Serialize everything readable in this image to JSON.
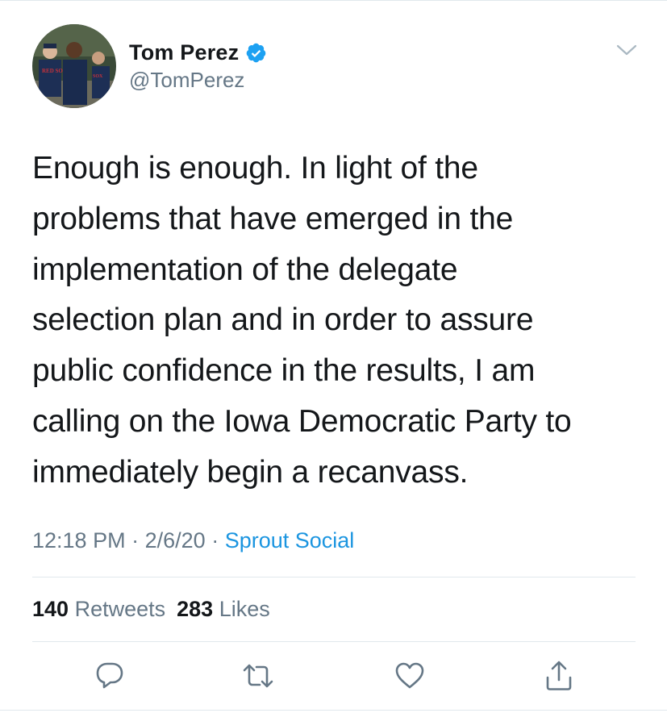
{
  "author": {
    "display_name": "Tom Perez",
    "handle": "@TomPerez",
    "verified": true,
    "avatar_icon": "profile-photo",
    "verified_icon": "verified-badge-icon",
    "verified_color": "#1da1f2"
  },
  "tweet": {
    "text_lines": [
      "Enough is enough. In light of the",
      "problems that have emerged in the",
      "implementation of the delegate",
      "selection plan and in order to assure",
      "public confidence in the results, I am",
      "calling on the Iowa Democratic Party to",
      "immediately begin a recanvass."
    ]
  },
  "meta": {
    "time": "12:18 PM",
    "separator": "·",
    "date": "2/6/20",
    "source": "Sprout Social",
    "source_color": "#1b95e0"
  },
  "stats": {
    "retweets_count": "140",
    "retweets_label": "Retweets",
    "likes_count": "283",
    "likes_label": "Likes"
  },
  "actions": [
    {
      "name": "reply",
      "icon": "reply-icon"
    },
    {
      "name": "retweet",
      "icon": "retweet-icon"
    },
    {
      "name": "like",
      "icon": "heart-icon"
    },
    {
      "name": "share",
      "icon": "share-icon"
    }
  ],
  "colors": {
    "text": "#14171a",
    "secondary": "#657786",
    "icon": "#657786",
    "divider": "#e1e8ed"
  }
}
